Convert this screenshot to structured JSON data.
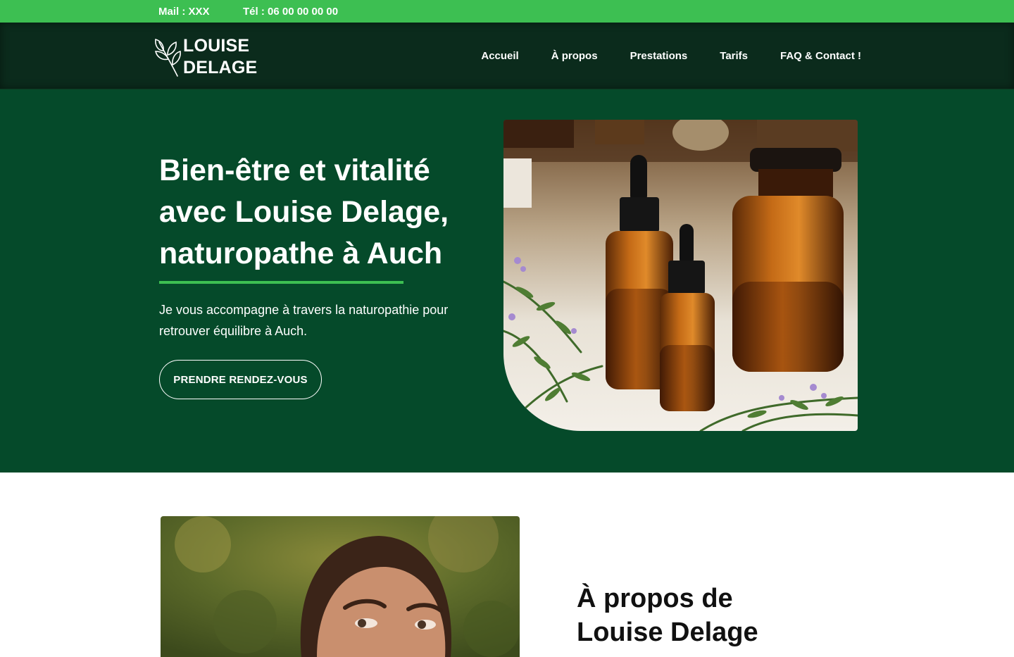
{
  "topbar": {
    "mail": "Mail : XXX",
    "tel": "Tél : 06 00 00 00 00"
  },
  "logo": {
    "line1": "LOUISE",
    "line2": "DELAGE",
    "icon": "leaf-branch-icon"
  },
  "nav": {
    "items": [
      {
        "label": "Accueil"
      },
      {
        "label": "À propos"
      },
      {
        "label": "Prestations"
      },
      {
        "label": "Tarifs"
      },
      {
        "label": "FAQ & Contact !"
      }
    ]
  },
  "hero": {
    "title": "Bien-être et vitalité avec Louise Delage, naturopathe à Auch",
    "subtitle": "Je vous accompagne à travers la naturopathie pour retrouver équilibre à Auch.",
    "cta": "PRENDRE RENDEZ-VOUS"
  },
  "about": {
    "title": "À propos de Louise Delage"
  },
  "colors": {
    "topbar": "#3dbf52",
    "header": "#0b2b1c",
    "hero": "#054a2a",
    "accent": "#3dbf52"
  }
}
